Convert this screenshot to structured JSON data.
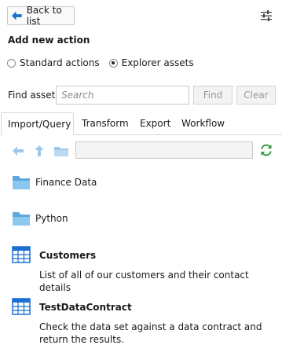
{
  "header": {
    "back_label": "Back to list"
  },
  "section_title": "Add new action",
  "mode": {
    "options": [
      "Standard actions",
      "Explorer assets"
    ],
    "selected": "Explorer assets"
  },
  "find": {
    "label": "Find asset",
    "placeholder": "Search",
    "value": "",
    "find_label": "Find",
    "clear_label": "Clear"
  },
  "tabs": [
    "Import/Query",
    "Transform",
    "Export",
    "Workflow"
  ],
  "active_tab": "Import/Query",
  "nav": {
    "path": ""
  },
  "items": [
    {
      "type": "folder",
      "name": "Finance Data"
    },
    {
      "type": "folder",
      "name": "Python"
    },
    {
      "type": "asset",
      "name": "Customers",
      "description": "List of all of our customers and their contact details"
    },
    {
      "type": "asset",
      "name": "TestDataContract",
      "description": "Check the data set against a data contract and return the results."
    }
  ],
  "colors": {
    "accent_blue": "#1a6fd1",
    "folder_blue": "#7fbfe8",
    "refresh_green": "#2e9a3a",
    "disabled_nav": "#9cc7ea"
  },
  "icons": {
    "back": "arrow-left-icon",
    "settings": "sliders-icon",
    "nav_back": "arrow-left-icon",
    "nav_up": "arrow-up-icon",
    "nav_folder": "folder-icon",
    "refresh": "refresh-icon",
    "folder": "folder-icon",
    "asset": "table-grid-icon"
  }
}
